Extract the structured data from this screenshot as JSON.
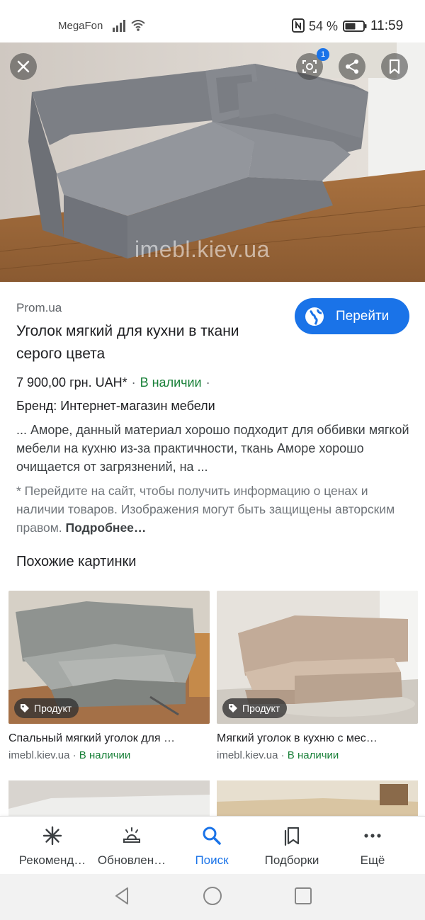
{
  "status_bar": {
    "carrier": "MegaFon",
    "battery_percent": "54 %",
    "time": "11:59"
  },
  "hero": {
    "watermark": "imebl.kiev.ua",
    "lens_badge_count": "1",
    "icons": [
      "close-icon",
      "lens-icon",
      "share-icon",
      "bookmark-icon"
    ]
  },
  "result": {
    "source": "Prom.ua",
    "visit_button": "Перейти",
    "title": "Уголок мягкий для кухни в ткани серого цвета",
    "price": "7 900,00 грн. UAH*",
    "dot": "·",
    "availability": "В наличии",
    "brand": "Бренд: Интернет-магазин мебели",
    "description": "... Аморе, данный материал хорошо подходит для оббивки мягкой мебели на кухню из-за практичности, ткань Аморе хорошо очищается от загрязнений, на ...",
    "disclaimer": "* Перейдите на сайт, чтобы получить информацию о ценах и наличии товаров. Изображения могут быть защищены авторским правом.",
    "more_link": "Подробнее…"
  },
  "similar": {
    "heading": "Похожие картинки",
    "cards": [
      {
        "chip": "Продукт",
        "title": "Спальный мягкий уголок для …",
        "site": "imebl.kiev.ua",
        "sep": " · ",
        "availability": "В наличии"
      },
      {
        "chip": "Продукт",
        "title": "Мягкий уголок в кухню с мес…",
        "site": "imebl.kiev.ua",
        "sep": " · ",
        "availability": "В наличии"
      }
    ]
  },
  "bottom_nav": {
    "items": [
      {
        "label": "Рекоменд…",
        "icon": "asterisk-icon"
      },
      {
        "label": "Обновлен…",
        "icon": "updates-icon"
      },
      {
        "label": "Поиск",
        "icon": "search-icon",
        "active": true
      },
      {
        "label": "Подборки",
        "icon": "collections-icon"
      },
      {
        "label": "Ещё",
        "icon": "more-dots-icon"
      }
    ]
  },
  "colors": {
    "accent": "#1a73e8",
    "in_stock": "#188038",
    "text": "#202124",
    "secondary": "#5f6368"
  }
}
